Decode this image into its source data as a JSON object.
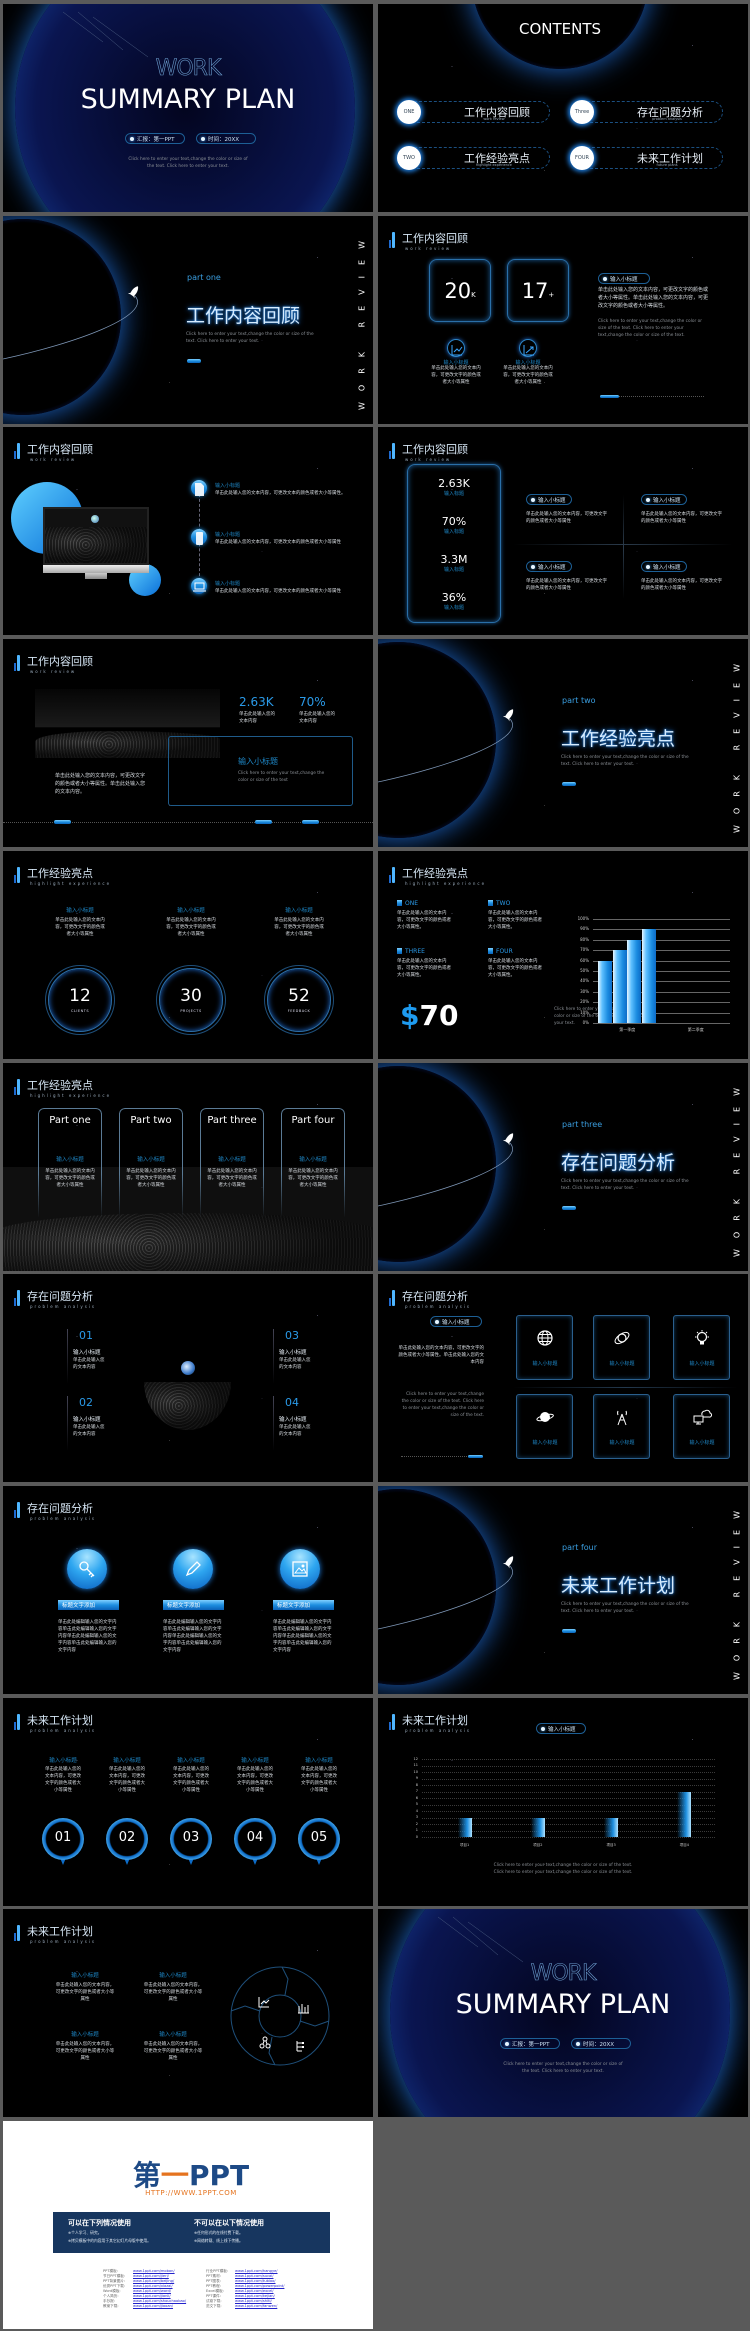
{
  "page": {
    "accent": "#1e88c8",
    "ring_white": "#e8f6ff",
    "ring_blue": "#1e6ad0",
    "background": "#5a5a5a"
  },
  "slides": [
    {
      "type": "cover",
      "work": "WORK",
      "title": "SUMMARY PLAN",
      "pills": [
        "汇报：第一PPT",
        "时间：20XX"
      ],
      "desc": "Click here to enter your text,change the color or size of the text. Click here to enter your text."
    },
    {
      "type": "contents",
      "title": "CONTENTS",
      "items": [
        {
          "num": "ONE",
          "title": "工作内容回顾",
          "sub": "work review"
        },
        {
          "num": "Three",
          "title": "存在问题分析",
          "sub": "problem analysis"
        },
        {
          "num": "TWO",
          "title": "工作经验亮点",
          "sub": "highlight experience"
        },
        {
          "num": "FOUR",
          "title": "未来工作计划",
          "sub": "future plans"
        }
      ]
    },
    {
      "type": "section",
      "part": "part one",
      "title": "工作内容回顾",
      "desc": "Click here to enter your text,change the color or size of the text. Click here to enter your text.",
      "side": "WORK REVIEW"
    },
    {
      "type": "stats",
      "header": {
        "title": "工作内容回顾",
        "sub": "work review"
      },
      "boxes": [
        {
          "value": "20",
          "unit": "K"
        },
        {
          "value": "17",
          "unit": "+"
        }
      ],
      "icons": [
        {
          "icon": "chart-icon",
          "label": "输入小标题",
          "text": "单击此处输入您的文本内容，可更改文字的颜色或者大小等属性"
        },
        {
          "icon": "growth-icon",
          "label": "输入小标题",
          "text": "单击此处输入您的文本内容，可更改文字的颜色或者大小等属性"
        }
      ],
      "pill": "输入小标题",
      "body": "单击此处输入您的文本内容，可更改文字的颜色或者大小等属性。单击此处输入您的文本内容，可更改文字的颜色或者大小等属性。",
      "click": "Click here to enter your text,change the color or size of the text. Click here to enter your text,change the color or size of the text.",
      "progress": 0.18
    },
    {
      "type": "timeline",
      "header": {
        "title": "工作内容回顾",
        "sub": "work review"
      },
      "items": [
        {
          "icon": "document-icon",
          "title": "输入小标题",
          "text": "单击此处输入您的文本内容，可更改文本的颜色或者大小等属性。"
        },
        {
          "icon": "phone-icon",
          "title": "输入小标题",
          "text": "单击此处输入您的文本内容，可更改文本的颜色或者大小等属性"
        },
        {
          "icon": "laptop-icon",
          "title": "输入小标题",
          "text": "单击此处输入您的文本内容，可更改文本的颜色或者大小等属性"
        }
      ]
    },
    {
      "type": "metrics",
      "header": {
        "title": "工作内容回顾",
        "sub": "work review"
      },
      "metrics": [
        {
          "value": "2.63K",
          "label": "输入标题"
        },
        {
          "value": "70%",
          "label": "输入标题"
        },
        {
          "value": "3.3M",
          "label": "输入标题"
        },
        {
          "value": "36%",
          "label": "输入标题"
        }
      ],
      "cards": [
        {
          "pill": "输入小标题",
          "text": "单击此处输入您的文本内容，可更改文字的颜色或者大小等属性"
        },
        {
          "pill": "输入小标题",
          "text": "单击此处输入您的文本内容，可更改文字的颜色或者大小等属性"
        },
        {
          "pill": "输入小标题",
          "text": "单击此处输入您的文本内容，可更改文字的颜色或者大小等属性"
        },
        {
          "pill": "输入小标题",
          "text": "单击此处输入您的文本内容，可更改文字的颜色或者大小等属性"
        }
      ]
    },
    {
      "type": "imagestats",
      "header": {
        "title": "工作内容回顾",
        "sub": "work review"
      },
      "stats": [
        {
          "value": "2.63K",
          "text": "单击此处输入您的文本内容"
        },
        {
          "value": "70%",
          "text": "单击此处输入您的文本内容"
        }
      ],
      "box": {
        "title": "输入小标题",
        "text": "Click here to enter your text,change the color or size of the text"
      },
      "left_text": "单击此处输入您的文本内容，可更改文字的颜色或者大小等属性。单击此处输入您的文本内容。"
    },
    {
      "type": "section",
      "part": "part two",
      "title": "工作经验亮点",
      "desc": "Click here to enter your text,change the color or size of the text. Click here to enter your text.",
      "side": "WORK REVIEW"
    },
    {
      "type": "circles",
      "header": {
        "title": "工作经验亮点",
        "sub": "highlight experience"
      },
      "cols": [
        {
          "title": "输入小标题",
          "text": "单击此处输入您的文本内容，可更改文字的颜色或者大小等属性",
          "value": "12",
          "label": "CLIENTS"
        },
        {
          "title": "输入小标题",
          "text": "单击此处输入您的文本内容，可更改文字的颜色或者大小等属性",
          "value": "30",
          "label": "PROJECTS"
        },
        {
          "title": "输入小标题",
          "text": "单击此处输入您的文本内容，可更改文字的颜色或者大小等属性",
          "value": "52",
          "label": "FEEDBACK"
        }
      ]
    },
    {
      "type": "barchart",
      "header": {
        "title": "工作经验亮点",
        "sub": "highlight experience"
      },
      "legend": [
        {
          "label": "ONE",
          "text": "单击此处输入您的文本内容，可更改文字的颜色或者大小等属性。"
        },
        {
          "label": "TWO",
          "text": "单击此处输入您的文本内容，可更改文字的颜色或者大小等属性。"
        },
        {
          "label": "THREE",
          "text": "单击此处输入您的文本内容，可更改文字的颜色或者大小等属性。"
        },
        {
          "label": "FOUR",
          "text": "单击此处输入您的文本内容，可更改文字的颜色或者大小等属性。"
        }
      ],
      "price": {
        "symbol": "$",
        "value": "70"
      },
      "click": "Click here to enter your text,change the color or size of the text. Click here to enter your text."
    },
    {
      "type": "parts",
      "header": {
        "title": "工作经验亮点",
        "sub": "highlight experience"
      },
      "cards": [
        {
          "title": "Part one",
          "sub": "输入小标题",
          "text": "单击此处输入您的文本内容，可更改文字的颜色或者大小等属性"
        },
        {
          "title": "Part two",
          "sub": "输入小标题",
          "text": "单击此处输入您的文本内容，可更改文字的颜色或者大小等属性"
        },
        {
          "title": "Part three",
          "sub": "输入小标题",
          "text": "单击此处输入您的文本内容，可更改文字的颜色或者大小等属性"
        },
        {
          "title": "Part four",
          "sub": "输入小标题",
          "text": "单击此处输入您的文本内容，可更改文字的颜色或者大小等属性"
        }
      ]
    },
    {
      "type": "section",
      "part": "part three",
      "title": "存在问题分析",
      "desc": "Click here to enter your text,change the color or size of the text. Click here to enter your text.",
      "side": "WORK REVIEW"
    },
    {
      "type": "quad",
      "header": {
        "title": "存在问题分析",
        "sub": "problem analysis"
      },
      "items": [
        {
          "num": "01",
          "title": "输入小标题",
          "text": "单击此处输入您的文本内容"
        },
        {
          "num": "02",
          "title": "输入小标题",
          "text": "单击此处输入您的文本内容"
        },
        {
          "num": "03",
          "title": "输入小标题",
          "text": "单击此处输入您的文本内容"
        },
        {
          "num": "04",
          "title": "输入小标题",
          "text": "单击此处输入您的文本内容"
        }
      ]
    },
    {
      "type": "icongrid",
      "header": {
        "title": "存在问题分析",
        "sub": "problem analysis"
      },
      "pill": "输入小标题",
      "body": "单击此处输入您的文本内容，可更改文字的颜色或者大小等属性。单击此处输入您的文本内容",
      "click": "Click here to enter your text,change the color or size of the text. Click here to enter your text,change the color or size of the text.",
      "icons": [
        {
          "icon": "globe-icon",
          "label": "输入小标题"
        },
        {
          "icon": "orbit-icon",
          "label": "输入小标题"
        },
        {
          "icon": "lightbulb-icon",
          "label": "输入小标题"
        },
        {
          "icon": "planet-icon",
          "label": "输入小标题"
        },
        {
          "icon": "signal-tower-icon",
          "label": "输入小标题"
        },
        {
          "icon": "cloud-computer-icon",
          "label": "输入小标题"
        }
      ]
    },
    {
      "type": "buttons",
      "header": {
        "title": "存在问题分析",
        "sub": "problem analysis"
      },
      "items": [
        {
          "icon": "key-icon",
          "button": "标题文字添加",
          "text": "单击此处编辑输入您的文字内容单击此处编辑输入您的文字内容单击此处编辑输入您的文字内容单击此处编辑输入您的文字内容"
        },
        {
          "icon": "pencil-icon",
          "button": "标题文字添加",
          "text": "单击此处编辑输入您的文字内容单击此处编辑输入您的文字内容单击此处编辑输入您的文字内容单击此处编辑输入您的文字内容"
        },
        {
          "icon": "image-icon",
          "button": "标题文字添加",
          "text": "单击此处编辑输入您的文字内容单击此处编辑输入您的文字内容单击此处编辑输入您的文字内容单击此处编辑输入您的文字内容"
        }
      ]
    },
    {
      "type": "section",
      "part": "part four",
      "title": "未来工作计划",
      "desc": "Click here to enter your text,change the color or size of the text. Click here to enter your text.",
      "side": "WORK REVIEW"
    },
    {
      "type": "pins",
      "header": {
        "title": "未来工作计划",
        "sub": "problem analysis"
      },
      "items": [
        {
          "num": "01",
          "title": "输入小标题",
          "text": "单击此处输入您的文本内容，可更改文字的颜色或者大小等属性"
        },
        {
          "num": "02",
          "title": "输入小标题",
          "text": "单击此处输入您的文本内容，可更改文字的颜色或者大小等属性"
        },
        {
          "num": "03",
          "title": "输入小标题",
          "text": "单击此处输入您的文本内容，可更改文字的颜色或者大小等属性"
        },
        {
          "num": "04",
          "title": "输入小标题",
          "text": "单击此处输入您的文本内容，可更改文字的颜色或者大小等属性"
        },
        {
          "num": "05",
          "title": "输入小标题",
          "text": "单击此处输入您的文本内容，可更改文字的颜色或者大小等属性"
        }
      ]
    },
    {
      "type": "barchart2",
      "header": {
        "title": "未来工作计划",
        "sub": "problem analysis"
      },
      "pill": "输入小标题",
      "caption": "Click here to enter your text,change the color or size of the text. Click here to enter your text,change the color or size of the text."
    },
    {
      "type": "cycle",
      "header": {
        "title": "未来工作计划",
        "sub": "problem analysis"
      },
      "items": [
        {
          "title": "输入小标题",
          "text": "单击此处输入您的文本内容，可更改文字的颜色或者大小等属性"
        },
        {
          "title": "输入小标题",
          "text": "单击此处输入您的文本内容，可更改文字的颜色或者大小等属性"
        },
        {
          "title": "输入小标题",
          "text": "单击此处输入您的文本内容，可更改文字的颜色或者大小等属性"
        },
        {
          "title": "输入小标题",
          "text": "单击此处输入您的文本内容，可更改文字的颜色或者大小等属性"
        }
      ],
      "icons": [
        "line-chart-icon",
        "bar-chart-icon",
        "network-icon",
        "flowchart-icon"
      ]
    },
    {
      "type": "cover",
      "work": "WORK",
      "title": "SUMMARY PLAN",
      "pills": [
        "汇报：第一PPT",
        "时间：20XX"
      ],
      "desc": "Click here to enter your text,change the color or size of the text. Click here to enter your text."
    }
  ],
  "chart_data": [
    {
      "type": "bar",
      "categories": [
        "第一季度",
        "第二季度"
      ],
      "series": [
        {
          "values": [
            60,
            null
          ]
        },
        {
          "values": [
            70,
            null
          ]
        },
        {
          "values": [
            80,
            null
          ]
        },
        {
          "values": [
            90,
            null
          ]
        }
      ],
      "ylim": [
        0,
        100
      ],
      "yticks": [
        "0%",
        "10%",
        "20%",
        "30%",
        "40%",
        "50%",
        "60%",
        "70%",
        "80%",
        "90%",
        "100%"
      ],
      "grid": true
    },
    {
      "type": "bar",
      "categories": [
        "项目1",
        "项目2",
        "项目3",
        "项目4"
      ],
      "values": [
        3,
        3,
        3,
        7
      ],
      "ylim": [
        0,
        12
      ],
      "yticks": [
        "0",
        "1",
        "2",
        "3",
        "4",
        "5",
        "6",
        "7",
        "8",
        "9",
        "10",
        "11",
        "12"
      ],
      "grid": true
    }
  ],
  "ad": {
    "logo": [
      "第",
      "一",
      "PPT"
    ],
    "url": "HTTP://WWW.1PPT.COM",
    "allowed": {
      "title": "可以在下列情况使用",
      "lines": [
        "※个人学习、研究。",
        "※拷贝模板中的内容用于其它幻灯片母版中使用。"
      ]
    },
    "forbidden": {
      "title": "不可以在以下情况使用",
      "lines": [
        "※任何形式的在线付费下载。",
        "※网络转载、线上线下传播。"
      ]
    },
    "links_left": [
      [
        "PPT模板:",
        "www.1ppt.com/moban/"
      ],
      [
        "节日PPT模板:",
        "www.1ppt.com/jieri/"
      ],
      [
        "PPT背景图片:",
        "www.1ppt.com/beijing/"
      ],
      [
        "优秀PPT下载:",
        "www.1ppt.com/xiazai/"
      ],
      [
        "Word模板:",
        "www.1ppt.com/word/"
      ],
      [
        "个人简历:",
        "www.1ppt.com/jianli/"
      ],
      [
        "手抄报:",
        "www.1ppt.com/shouchaobao/"
      ],
      [
        "教案下载:",
        "www.1ppt.com/jiaoan/"
      ]
    ],
    "links_right": [
      [
        "行业PPT模板:",
        "www.1ppt.com/hangye/"
      ],
      [
        "PPT素材:",
        "www.1ppt.com/sucai/"
      ],
      [
        "PPT图表:",
        "www.1ppt.com/tubiao/"
      ],
      [
        "PPT教程:",
        "www.1ppt.com/powerpoint/"
      ],
      [
        "Excel模板:",
        "www.1ppt.com/excel/"
      ],
      [
        "PPT课件:",
        "www.1ppt.com/kejian/"
      ],
      [
        "试卷下载:",
        "www.1ppt.com/shiti/"
      ],
      [
        "范文下载:",
        "www.1ppt.com/fanwen/"
      ]
    ]
  }
}
